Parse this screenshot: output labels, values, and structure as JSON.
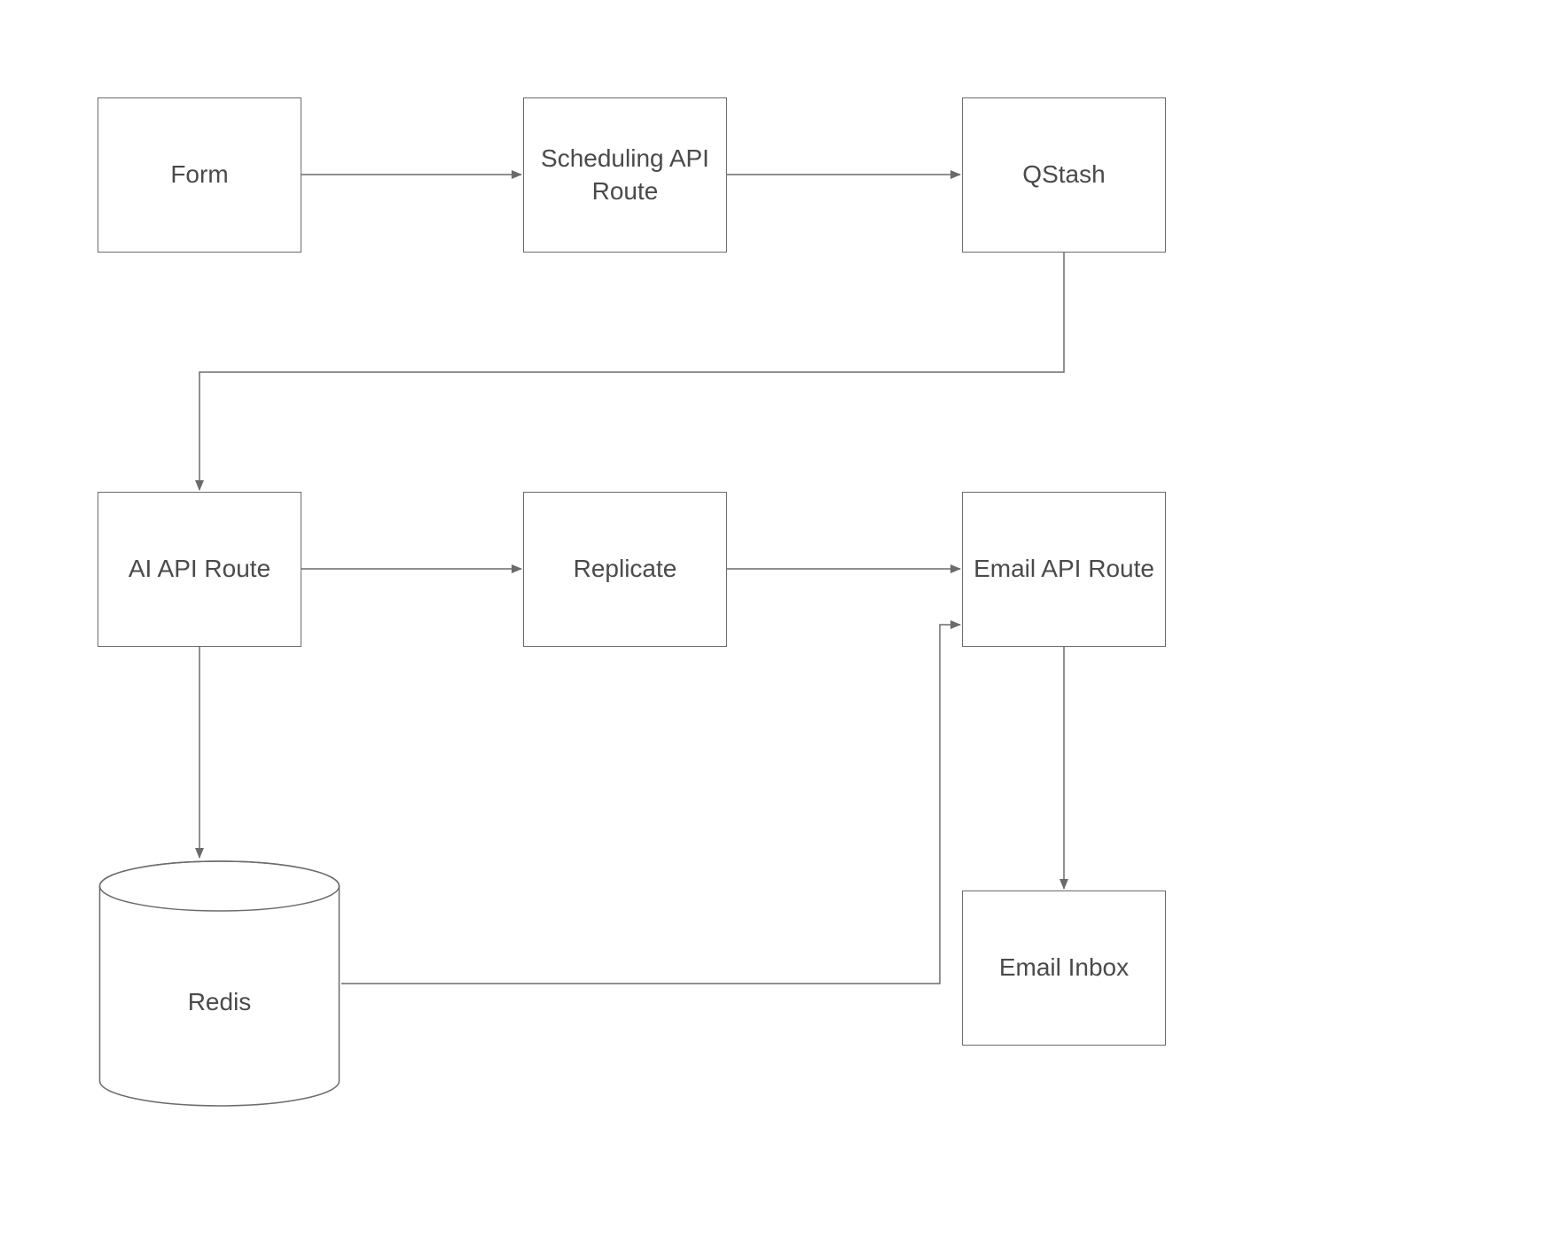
{
  "diagram": {
    "type": "flowchart",
    "nodes": {
      "form": {
        "label": "Form",
        "shape": "rectangle"
      },
      "scheduling": {
        "label": "Scheduling API\nRoute",
        "shape": "rectangle"
      },
      "qstash": {
        "label": "QStash",
        "shape": "rectangle"
      },
      "ai_api": {
        "label": "AI API Route",
        "shape": "rectangle"
      },
      "replicate": {
        "label": "Replicate",
        "shape": "rectangle"
      },
      "email_api": {
        "label": "Email API Route",
        "shape": "rectangle"
      },
      "redis": {
        "label": "Redis",
        "shape": "cylinder"
      },
      "email_inbox": {
        "label": "Email Inbox",
        "shape": "rectangle"
      }
    },
    "edges": [
      {
        "from": "form",
        "to": "scheduling"
      },
      {
        "from": "scheduling",
        "to": "qstash"
      },
      {
        "from": "qstash",
        "to": "ai_api"
      },
      {
        "from": "ai_api",
        "to": "replicate"
      },
      {
        "from": "replicate",
        "to": "email_api"
      },
      {
        "from": "ai_api",
        "to": "redis"
      },
      {
        "from": "redis",
        "to": "email_api"
      },
      {
        "from": "email_api",
        "to": "email_inbox"
      }
    ],
    "colors": {
      "stroke": "#6b6b6b",
      "text": "#4a4a4a",
      "background": "#ffffff"
    }
  }
}
